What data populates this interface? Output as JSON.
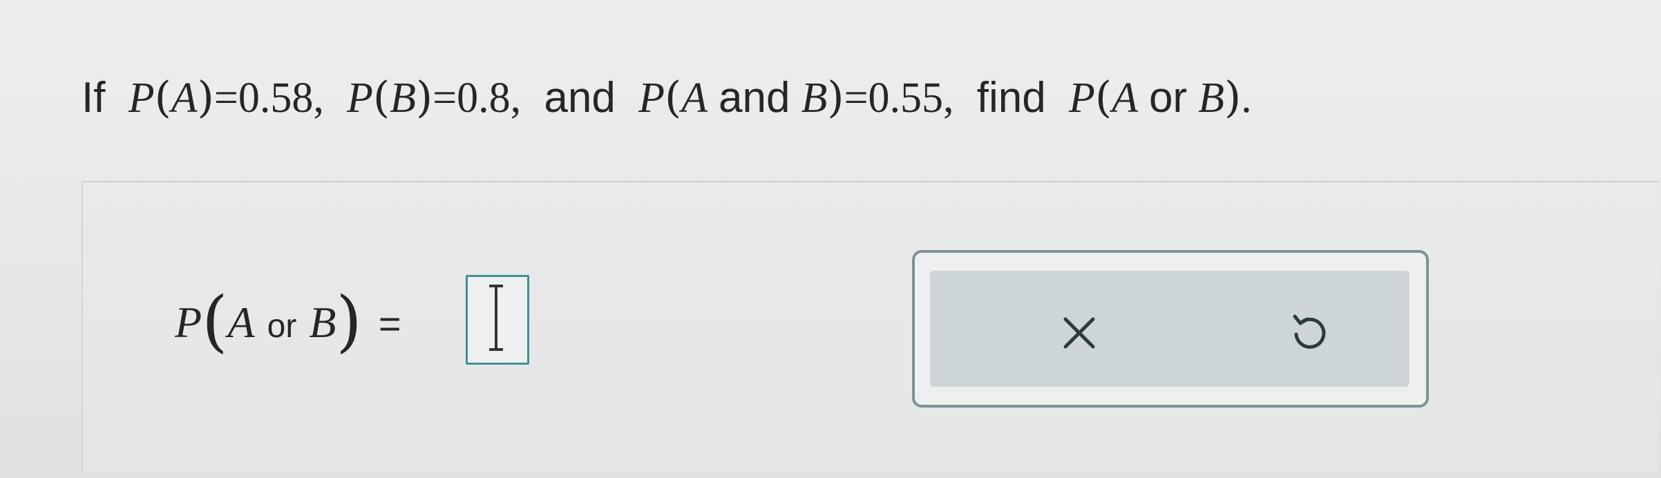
{
  "question": {
    "lead": "If",
    "p": "P",
    "a": "A",
    "b": "B",
    "eq": "=",
    "val_a": "0.58",
    "val_b": "0.8",
    "and_word": "and",
    "val_ab": "0.55",
    "find_word": "find",
    "or_word": "or",
    "comma": ",",
    "period": "."
  },
  "answer": {
    "p": "P",
    "a": "A",
    "or_word": "or",
    "b": "B",
    "eq": "=",
    "input_value": ""
  },
  "tools": {
    "clear_icon": "close-icon",
    "undo_icon": "undo-icon"
  }
}
